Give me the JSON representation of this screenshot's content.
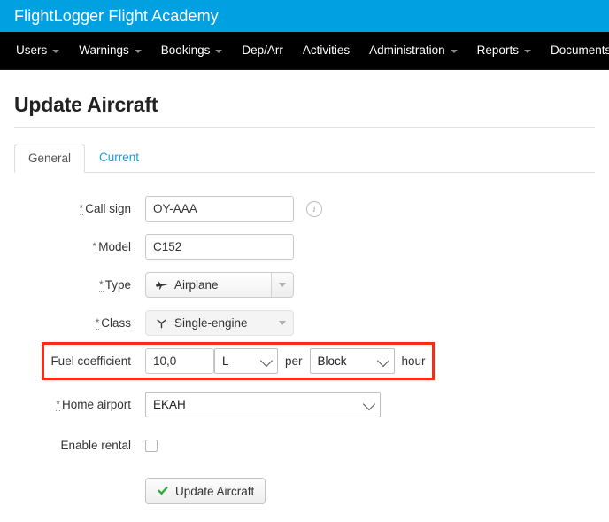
{
  "header": {
    "brand_title": "FlightLogger Flight Academy",
    "brand_color": "#00a0e1",
    "nav_background": "#000000"
  },
  "nav": {
    "items": [
      {
        "label": "Users",
        "has_caret": true
      },
      {
        "label": "Warnings",
        "has_caret": true
      },
      {
        "label": "Bookings",
        "has_caret": true
      },
      {
        "label": "Dep/Arr",
        "has_caret": false
      },
      {
        "label": "Activities",
        "has_caret": false
      },
      {
        "label": "Administration",
        "has_caret": true
      },
      {
        "label": "Reports",
        "has_caret": true
      },
      {
        "label": "Documents",
        "has_caret": false
      }
    ]
  },
  "page": {
    "title": "Update Aircraft"
  },
  "tabs": [
    {
      "label": "General",
      "active": true
    },
    {
      "label": "Current",
      "active": false
    }
  ],
  "form": {
    "required_marker": "*",
    "call_sign": {
      "label": "Call sign",
      "value": "OY-AAA",
      "placeholder": "",
      "required": true,
      "info_icon": "info-circle-icon",
      "info_glyph": "i"
    },
    "model": {
      "label": "Model",
      "value": "C152",
      "placeholder": "",
      "required": true
    },
    "type": {
      "label": "Type",
      "value": "Airplane",
      "icon": "airplane-icon",
      "required": true
    },
    "aircraft_class": {
      "label": "Class",
      "value": "Single-engine",
      "icon": "propeller-icon",
      "required": true
    },
    "fuel_coefficient": {
      "label": "Fuel coefficient",
      "amount": "10,0",
      "unit": "L",
      "per_text": "per",
      "basis": "Block",
      "hour_text": "hour",
      "required": false,
      "highlight_color": "#f42d17"
    },
    "home_airport": {
      "label": "Home airport",
      "value": "EKAH",
      "required": true
    },
    "enable_rental": {
      "label": "Enable rental",
      "checked": false
    },
    "submit": {
      "label": "Update Aircraft",
      "icon": "check-icon",
      "icon_color": "#2eac3a"
    }
  }
}
